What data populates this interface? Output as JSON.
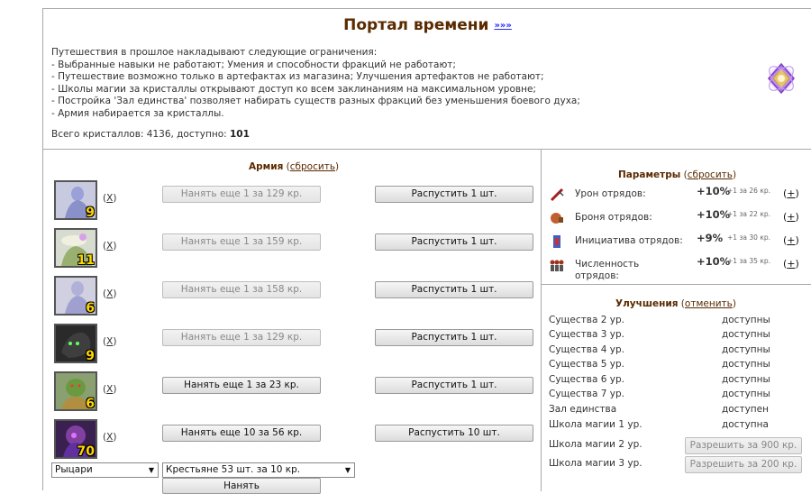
{
  "header": {
    "title": "Портал времени",
    "more_link": "»»»"
  },
  "info_lines": [
    "Путешествия в прошлое накладывают следующие ограничения:",
    "- Выбранные навыки не работают; Умения и способности фракций не работают;",
    "- Путешествие возможно только в артефактах из магазина; Улучшения артефактов не работают;",
    "- Школы магии за кристаллы открывают доступ ко всем заклинаниям на максимальном уровне;",
    "- Постройка 'Зал единства' позволяет набирать существ разных фракций без уменьшения боевого духа;",
    "- Армия набирается за кристаллы."
  ],
  "crystals": {
    "prefix": "Всего кристаллов: 4136, доступно:",
    "available": "101"
  },
  "army": {
    "title": "Армия",
    "reset_prefix": " (",
    "reset": "сбросить",
    "reset_suffix": ")",
    "x_label": "X",
    "units": [
      {
        "count": "9",
        "hire": "Нанять еще 1 за 129 кр.",
        "hire_enabled": false,
        "dismiss": "Распустить 1 шт."
      },
      {
        "count": "11",
        "hire": "Нанять еще 1 за 159 кр.",
        "hire_enabled": false,
        "dismiss": "Распустить 1 шт."
      },
      {
        "count": "6",
        "hire": "Нанять еще 1 за 158 кр.",
        "hire_enabled": false,
        "dismiss": "Распустить 1 шт."
      },
      {
        "count": "9",
        "hire": "Нанять еще 1 за 129 кр.",
        "hire_enabled": false,
        "dismiss": "Распустить 1 шт."
      },
      {
        "count": "6",
        "hire": "Нанять еще 1 за 23 кр.",
        "hire_enabled": true,
        "dismiss": "Распустить 1 шт."
      },
      {
        "count": "70",
        "hire": "Нанять еще 10 за 56 кр.",
        "hire_enabled": true,
        "dismiss": "Распустить 10 шт."
      }
    ],
    "faction_select": "Рыцари",
    "unit_select": "Крестьяне 53 шт. за 10 кр.",
    "hire_button": "Нанять"
  },
  "params": {
    "title": "Параметры",
    "reset": "сбросить",
    "plus_label": "+",
    "rows": [
      {
        "label": "Урон отрядов:",
        "value": "+10%",
        "note": "+1 за 26 кр.",
        "icon": "damage-icon"
      },
      {
        "label": "Броня отрядов:",
        "value": "+10%",
        "note": "+1 за 22 кр.",
        "icon": "armor-icon"
      },
      {
        "label": "Инициатива отрядов:",
        "value": "+9%",
        "note": "+1 за 30 кр.",
        "icon": "initiative-icon"
      },
      {
        "label": "Численность отрядов:",
        "value": "+10%",
        "note": "+1 за 35 кр.",
        "icon": "quantity-icon"
      }
    ]
  },
  "upgrades": {
    "title": "Улучшения",
    "cancel": "отменить",
    "rows": [
      {
        "label": "Существа 2 ур.",
        "status": "доступны"
      },
      {
        "label": "Существа 3 ур.",
        "status": "доступны"
      },
      {
        "label": "Существа 4 ур.",
        "status": "доступны"
      },
      {
        "label": "Существа 5 ур.",
        "status": "доступны"
      },
      {
        "label": "Существа 6 ур.",
        "status": "доступны"
      },
      {
        "label": "Существа 7 ур.",
        "status": "доступны"
      },
      {
        "label": "Зал единства",
        "status": "доступен"
      },
      {
        "label": "Школа магии 1 ур.",
        "status": "доступна"
      }
    ],
    "button_rows": [
      {
        "label": "Школа магии 2 ур.",
        "button": "Разрешить за 900 кр."
      },
      {
        "label": "Школа магии 3 ур.",
        "button": "Разрешить за 200 кр."
      }
    ]
  }
}
